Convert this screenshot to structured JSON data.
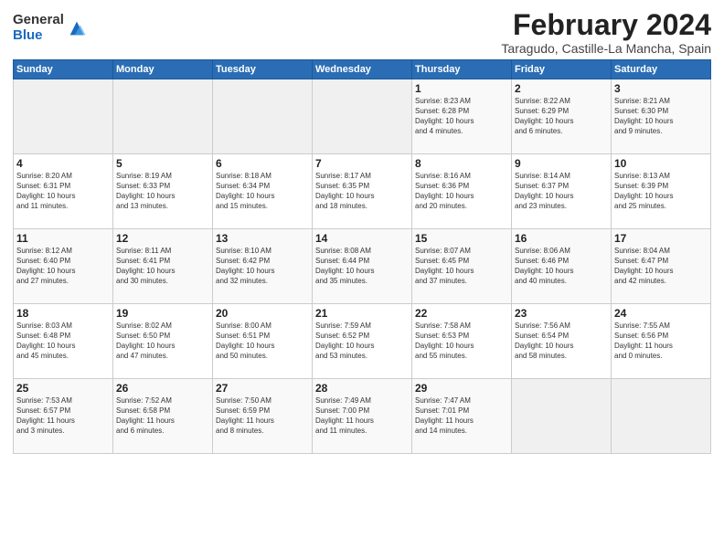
{
  "header": {
    "logo_general": "General",
    "logo_blue": "Blue",
    "month_year": "February 2024",
    "location": "Taragudo, Castille-La Mancha, Spain"
  },
  "days_of_week": [
    "Sunday",
    "Monday",
    "Tuesday",
    "Wednesday",
    "Thursday",
    "Friday",
    "Saturday"
  ],
  "weeks": [
    [
      {
        "day": "",
        "info": ""
      },
      {
        "day": "",
        "info": ""
      },
      {
        "day": "",
        "info": ""
      },
      {
        "day": "",
        "info": ""
      },
      {
        "day": "1",
        "info": "Sunrise: 8:23 AM\nSunset: 6:28 PM\nDaylight: 10 hours\nand 4 minutes."
      },
      {
        "day": "2",
        "info": "Sunrise: 8:22 AM\nSunset: 6:29 PM\nDaylight: 10 hours\nand 6 minutes."
      },
      {
        "day": "3",
        "info": "Sunrise: 8:21 AM\nSunset: 6:30 PM\nDaylight: 10 hours\nand 9 minutes."
      }
    ],
    [
      {
        "day": "4",
        "info": "Sunrise: 8:20 AM\nSunset: 6:31 PM\nDaylight: 10 hours\nand 11 minutes."
      },
      {
        "day": "5",
        "info": "Sunrise: 8:19 AM\nSunset: 6:33 PM\nDaylight: 10 hours\nand 13 minutes."
      },
      {
        "day": "6",
        "info": "Sunrise: 8:18 AM\nSunset: 6:34 PM\nDaylight: 10 hours\nand 15 minutes."
      },
      {
        "day": "7",
        "info": "Sunrise: 8:17 AM\nSunset: 6:35 PM\nDaylight: 10 hours\nand 18 minutes."
      },
      {
        "day": "8",
        "info": "Sunrise: 8:16 AM\nSunset: 6:36 PM\nDaylight: 10 hours\nand 20 minutes."
      },
      {
        "day": "9",
        "info": "Sunrise: 8:14 AM\nSunset: 6:37 PM\nDaylight: 10 hours\nand 23 minutes."
      },
      {
        "day": "10",
        "info": "Sunrise: 8:13 AM\nSunset: 6:39 PM\nDaylight: 10 hours\nand 25 minutes."
      }
    ],
    [
      {
        "day": "11",
        "info": "Sunrise: 8:12 AM\nSunset: 6:40 PM\nDaylight: 10 hours\nand 27 minutes."
      },
      {
        "day": "12",
        "info": "Sunrise: 8:11 AM\nSunset: 6:41 PM\nDaylight: 10 hours\nand 30 minutes."
      },
      {
        "day": "13",
        "info": "Sunrise: 8:10 AM\nSunset: 6:42 PM\nDaylight: 10 hours\nand 32 minutes."
      },
      {
        "day": "14",
        "info": "Sunrise: 8:08 AM\nSunset: 6:44 PM\nDaylight: 10 hours\nand 35 minutes."
      },
      {
        "day": "15",
        "info": "Sunrise: 8:07 AM\nSunset: 6:45 PM\nDaylight: 10 hours\nand 37 minutes."
      },
      {
        "day": "16",
        "info": "Sunrise: 8:06 AM\nSunset: 6:46 PM\nDaylight: 10 hours\nand 40 minutes."
      },
      {
        "day": "17",
        "info": "Sunrise: 8:04 AM\nSunset: 6:47 PM\nDaylight: 10 hours\nand 42 minutes."
      }
    ],
    [
      {
        "day": "18",
        "info": "Sunrise: 8:03 AM\nSunset: 6:48 PM\nDaylight: 10 hours\nand 45 minutes."
      },
      {
        "day": "19",
        "info": "Sunrise: 8:02 AM\nSunset: 6:50 PM\nDaylight: 10 hours\nand 47 minutes."
      },
      {
        "day": "20",
        "info": "Sunrise: 8:00 AM\nSunset: 6:51 PM\nDaylight: 10 hours\nand 50 minutes."
      },
      {
        "day": "21",
        "info": "Sunrise: 7:59 AM\nSunset: 6:52 PM\nDaylight: 10 hours\nand 53 minutes."
      },
      {
        "day": "22",
        "info": "Sunrise: 7:58 AM\nSunset: 6:53 PM\nDaylight: 10 hours\nand 55 minutes."
      },
      {
        "day": "23",
        "info": "Sunrise: 7:56 AM\nSunset: 6:54 PM\nDaylight: 10 hours\nand 58 minutes."
      },
      {
        "day": "24",
        "info": "Sunrise: 7:55 AM\nSunset: 6:56 PM\nDaylight: 11 hours\nand 0 minutes."
      }
    ],
    [
      {
        "day": "25",
        "info": "Sunrise: 7:53 AM\nSunset: 6:57 PM\nDaylight: 11 hours\nand 3 minutes."
      },
      {
        "day": "26",
        "info": "Sunrise: 7:52 AM\nSunset: 6:58 PM\nDaylight: 11 hours\nand 6 minutes."
      },
      {
        "day": "27",
        "info": "Sunrise: 7:50 AM\nSunset: 6:59 PM\nDaylight: 11 hours\nand 8 minutes."
      },
      {
        "day": "28",
        "info": "Sunrise: 7:49 AM\nSunset: 7:00 PM\nDaylight: 11 hours\nand 11 minutes."
      },
      {
        "day": "29",
        "info": "Sunrise: 7:47 AM\nSunset: 7:01 PM\nDaylight: 11 hours\nand 14 minutes."
      },
      {
        "day": "",
        "info": ""
      },
      {
        "day": "",
        "info": ""
      }
    ]
  ]
}
